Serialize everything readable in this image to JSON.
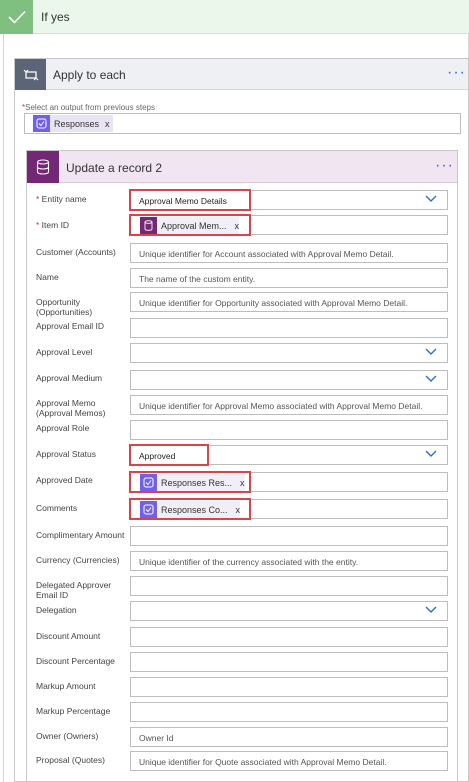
{
  "condition": {
    "title": "If yes"
  },
  "apply_to_each": {
    "title": "Apply to each",
    "select_label": "Select an output from previous steps",
    "token_label": "Responses",
    "token_remove": "x"
  },
  "update_record": {
    "title": "Update a record 2",
    "fields": [
      {
        "label": "Entity name",
        "required": true,
        "value": "Approval Memo Details",
        "dropdown": true,
        "highlight": true
      },
      {
        "label": "Item ID",
        "required": true,
        "token": "Approval Mem...",
        "token_icon": "database-icon",
        "highlight": true
      },
      {
        "label": "Customer (Accounts)",
        "placeholder": "Unique identifier for Account associated with Approval Memo Detail."
      },
      {
        "label": "Name",
        "placeholder": "The name of the custom entity."
      },
      {
        "label": "Opportunity (Opportunities)",
        "placeholder": "Unique identifier for Opportunity associated with Approval Memo Detail."
      },
      {
        "label": "Approval Email ID",
        "placeholder": ""
      },
      {
        "label": "Approval Level",
        "dropdown": true
      },
      {
        "label": "Approval Medium",
        "dropdown": true
      },
      {
        "label": "Approval Memo (Approval Memos)",
        "placeholder": "Unique identifier for Approval Memo associated with Approval Memo Detail."
      },
      {
        "label": "Approval Role",
        "placeholder": ""
      },
      {
        "label": "Approval Status",
        "value": "Approved",
        "dropdown": true,
        "highlight": true
      },
      {
        "label": "Approved Date",
        "token": "Responses Res...",
        "token_icon": "forms-icon",
        "highlight": true
      },
      {
        "label": "Comments",
        "token": "Responses Co...",
        "token_icon": "forms-icon",
        "highlight": true
      },
      {
        "label": "Complimentary Amount",
        "placeholder": ""
      },
      {
        "label": "Currency (Currencies)",
        "placeholder": "Unique identifier of the currency associated with the entity."
      },
      {
        "label": "Delegated Approver Email ID",
        "placeholder": ""
      },
      {
        "label": "Delegation",
        "dropdown": true
      },
      {
        "label": "Discount Amount",
        "placeholder": ""
      },
      {
        "label": "Discount Percentage",
        "placeholder": ""
      },
      {
        "label": "Markup Amount",
        "placeholder": ""
      },
      {
        "label": "Markup Percentage",
        "placeholder": ""
      },
      {
        "label": "Owner (Owners)",
        "placeholder": "Owner Id"
      },
      {
        "label": "Proposal (Quotes)",
        "placeholder": "Unique identifier for Quote associated with Approval Memo Detail."
      }
    ]
  },
  "colors": {
    "condition_green": "#7fbf7f",
    "dataverse_purple": "#742774",
    "forms_purple": "#7160e8",
    "highlight_red": "#d9434a",
    "link_blue": "#2b6fc9"
  }
}
